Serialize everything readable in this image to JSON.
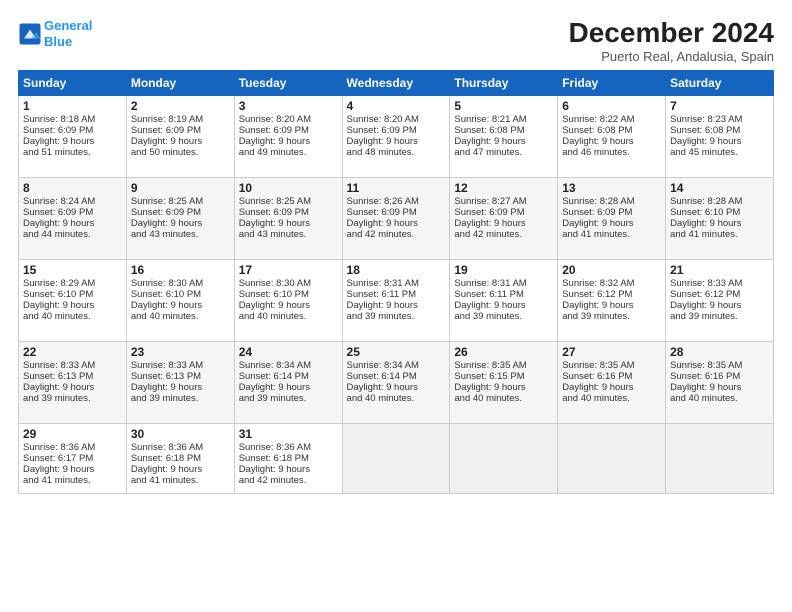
{
  "logo": {
    "line1": "General",
    "line2": "Blue"
  },
  "title": "December 2024",
  "subtitle": "Puerto Real, Andalusia, Spain",
  "days_of_week": [
    "Sunday",
    "Monday",
    "Tuesday",
    "Wednesday",
    "Thursday",
    "Friday",
    "Saturday"
  ],
  "weeks": [
    [
      {
        "day": "1",
        "lines": [
          "Sunrise: 8:18 AM",
          "Sunset: 6:09 PM",
          "Daylight: 9 hours",
          "and 51 minutes."
        ]
      },
      {
        "day": "2",
        "lines": [
          "Sunrise: 8:19 AM",
          "Sunset: 6:09 PM",
          "Daylight: 9 hours",
          "and 50 minutes."
        ]
      },
      {
        "day": "3",
        "lines": [
          "Sunrise: 8:20 AM",
          "Sunset: 6:09 PM",
          "Daylight: 9 hours",
          "and 49 minutes."
        ]
      },
      {
        "day": "4",
        "lines": [
          "Sunrise: 8:20 AM",
          "Sunset: 6:09 PM",
          "Daylight: 9 hours",
          "and 48 minutes."
        ]
      },
      {
        "day": "5",
        "lines": [
          "Sunrise: 8:21 AM",
          "Sunset: 6:08 PM",
          "Daylight: 9 hours",
          "and 47 minutes."
        ]
      },
      {
        "day": "6",
        "lines": [
          "Sunrise: 8:22 AM",
          "Sunset: 6:08 PM",
          "Daylight: 9 hours",
          "and 46 minutes."
        ]
      },
      {
        "day": "7",
        "lines": [
          "Sunrise: 8:23 AM",
          "Sunset: 6:08 PM",
          "Daylight: 9 hours",
          "and 45 minutes."
        ]
      }
    ],
    [
      {
        "day": "8",
        "lines": [
          "Sunrise: 8:24 AM",
          "Sunset: 6:09 PM",
          "Daylight: 9 hours",
          "and 44 minutes."
        ]
      },
      {
        "day": "9",
        "lines": [
          "Sunrise: 8:25 AM",
          "Sunset: 6:09 PM",
          "Daylight: 9 hours",
          "and 43 minutes."
        ]
      },
      {
        "day": "10",
        "lines": [
          "Sunrise: 8:25 AM",
          "Sunset: 6:09 PM",
          "Daylight: 9 hours",
          "and 43 minutes."
        ]
      },
      {
        "day": "11",
        "lines": [
          "Sunrise: 8:26 AM",
          "Sunset: 6:09 PM",
          "Daylight: 9 hours",
          "and 42 minutes."
        ]
      },
      {
        "day": "12",
        "lines": [
          "Sunrise: 8:27 AM",
          "Sunset: 6:09 PM",
          "Daylight: 9 hours",
          "and 42 minutes."
        ]
      },
      {
        "day": "13",
        "lines": [
          "Sunrise: 8:28 AM",
          "Sunset: 6:09 PM",
          "Daylight: 9 hours",
          "and 41 minutes."
        ]
      },
      {
        "day": "14",
        "lines": [
          "Sunrise: 8:28 AM",
          "Sunset: 6:10 PM",
          "Daylight: 9 hours",
          "and 41 minutes."
        ]
      }
    ],
    [
      {
        "day": "15",
        "lines": [
          "Sunrise: 8:29 AM",
          "Sunset: 6:10 PM",
          "Daylight: 9 hours",
          "and 40 minutes."
        ]
      },
      {
        "day": "16",
        "lines": [
          "Sunrise: 8:30 AM",
          "Sunset: 6:10 PM",
          "Daylight: 9 hours",
          "and 40 minutes."
        ]
      },
      {
        "day": "17",
        "lines": [
          "Sunrise: 8:30 AM",
          "Sunset: 6:10 PM",
          "Daylight: 9 hours",
          "and 40 minutes."
        ]
      },
      {
        "day": "18",
        "lines": [
          "Sunrise: 8:31 AM",
          "Sunset: 6:11 PM",
          "Daylight: 9 hours",
          "and 39 minutes."
        ]
      },
      {
        "day": "19",
        "lines": [
          "Sunrise: 8:31 AM",
          "Sunset: 6:11 PM",
          "Daylight: 9 hours",
          "and 39 minutes."
        ]
      },
      {
        "day": "20",
        "lines": [
          "Sunrise: 8:32 AM",
          "Sunset: 6:12 PM",
          "Daylight: 9 hours",
          "and 39 minutes."
        ]
      },
      {
        "day": "21",
        "lines": [
          "Sunrise: 8:33 AM",
          "Sunset: 6:12 PM",
          "Daylight: 9 hours",
          "and 39 minutes."
        ]
      }
    ],
    [
      {
        "day": "22",
        "lines": [
          "Sunrise: 8:33 AM",
          "Sunset: 6:13 PM",
          "Daylight: 9 hours",
          "and 39 minutes."
        ]
      },
      {
        "day": "23",
        "lines": [
          "Sunrise: 8:33 AM",
          "Sunset: 6:13 PM",
          "Daylight: 9 hours",
          "and 39 minutes."
        ]
      },
      {
        "day": "24",
        "lines": [
          "Sunrise: 8:34 AM",
          "Sunset: 6:14 PM",
          "Daylight: 9 hours",
          "and 39 minutes."
        ]
      },
      {
        "day": "25",
        "lines": [
          "Sunrise: 8:34 AM",
          "Sunset: 6:14 PM",
          "Daylight: 9 hours",
          "and 40 minutes."
        ]
      },
      {
        "day": "26",
        "lines": [
          "Sunrise: 8:35 AM",
          "Sunset: 6:15 PM",
          "Daylight: 9 hours",
          "and 40 minutes."
        ]
      },
      {
        "day": "27",
        "lines": [
          "Sunrise: 8:35 AM",
          "Sunset: 6:16 PM",
          "Daylight: 9 hours",
          "and 40 minutes."
        ]
      },
      {
        "day": "28",
        "lines": [
          "Sunrise: 8:35 AM",
          "Sunset: 6:16 PM",
          "Daylight: 9 hours",
          "and 40 minutes."
        ]
      }
    ],
    [
      {
        "day": "29",
        "lines": [
          "Sunrise: 8:36 AM",
          "Sunset: 6:17 PM",
          "Daylight: 9 hours",
          "and 41 minutes."
        ]
      },
      {
        "day": "30",
        "lines": [
          "Sunrise: 8:36 AM",
          "Sunset: 6:18 PM",
          "Daylight: 9 hours",
          "and 41 minutes."
        ]
      },
      {
        "day": "31",
        "lines": [
          "Sunrise: 8:36 AM",
          "Sunset: 6:18 PM",
          "Daylight: 9 hours",
          "and 42 minutes."
        ]
      },
      null,
      null,
      null,
      null
    ]
  ]
}
